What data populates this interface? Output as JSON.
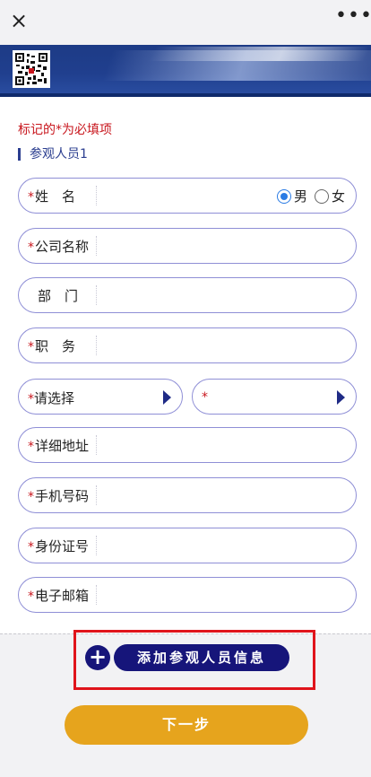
{
  "topbar": {
    "close_icon": "×",
    "more_icon": "•••"
  },
  "form": {
    "required_note": "标记的*为必填项",
    "section_title": "参观人员1",
    "fields": [
      {
        "required": "*",
        "label": "姓　名"
      },
      {
        "required": "*",
        "label": "公司名称"
      },
      {
        "required": "",
        "label": "部　门"
      },
      {
        "required": "*",
        "label": "职　务"
      },
      {
        "required": "*",
        "label": "详细地址"
      },
      {
        "required": "*",
        "label": "手机号码"
      },
      {
        "required": "*",
        "label": "身份证号"
      },
      {
        "required": "*",
        "label": "电子邮箱"
      }
    ],
    "gender": {
      "male": "男",
      "female": "女",
      "selected": "男"
    },
    "select_left": {
      "required": "*",
      "label": "请选择"
    },
    "select_right": {
      "required": "*",
      "label": ""
    }
  },
  "actions": {
    "add_plus": "+",
    "add_label": "添加参观人员信息",
    "next_label": "下一步"
  },
  "colors": {
    "accent_navy": "#16157a",
    "required_red": "#c8161d",
    "next_orange": "#e6a41d"
  }
}
